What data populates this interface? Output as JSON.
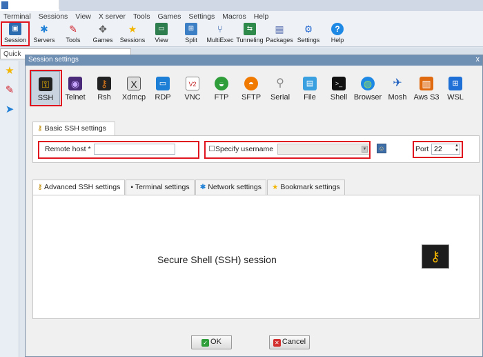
{
  "menubar": {
    "items": [
      "Terminal",
      "Sessions",
      "View",
      "X server",
      "Tools",
      "Games",
      "Settings",
      "Macros",
      "Help"
    ]
  },
  "toolbar": {
    "buttons": [
      {
        "label": "Session",
        "icon": "session-monitor-icon"
      },
      {
        "label": "Servers",
        "icon": "servers-icon"
      },
      {
        "label": "Tools",
        "icon": "tools-icon"
      },
      {
        "label": "Games",
        "icon": "games-icon"
      },
      {
        "label": "Sessions",
        "icon": "star-icon"
      },
      {
        "label": "View",
        "icon": "view-icon"
      },
      {
        "label": "Split",
        "icon": "split-icon"
      },
      {
        "label": "MultiExec",
        "icon": "multiexec-icon"
      },
      {
        "label": "Tunneling",
        "icon": "tunneling-icon"
      },
      {
        "label": "Packages",
        "icon": "packages-icon"
      },
      {
        "label": "Settings",
        "icon": "gear-icon"
      },
      {
        "label": "Help",
        "icon": "help-icon"
      }
    ]
  },
  "quick_connect": {
    "label": "Quick"
  },
  "dialog": {
    "title": "Session settings",
    "close": "x",
    "protocols": [
      {
        "label": "SSH",
        "icon": "key-icon"
      },
      {
        "label": "Telnet",
        "icon": "telnet-icon"
      },
      {
        "label": "Rsh",
        "icon": "rsh-icon"
      },
      {
        "label": "Xdmcp",
        "icon": "xdmcp-icon"
      },
      {
        "label": "RDP",
        "icon": "rdp-icon"
      },
      {
        "label": "VNC",
        "icon": "vnc-icon"
      },
      {
        "label": "FTP",
        "icon": "ftp-icon"
      },
      {
        "label": "SFTP",
        "icon": "sftp-icon"
      },
      {
        "label": "Serial",
        "icon": "serial-icon"
      },
      {
        "label": "File",
        "icon": "file-icon"
      },
      {
        "label": "Shell",
        "icon": "shell-icon"
      },
      {
        "label": "Browser",
        "icon": "browser-icon"
      },
      {
        "label": "Mosh",
        "icon": "mosh-icon"
      },
      {
        "label": "Aws S3",
        "icon": "aws-s3-icon"
      },
      {
        "label": "WSL",
        "icon": "wsl-icon"
      }
    ],
    "basic_tab": "Basic SSH settings",
    "remote_host": {
      "label": "Remote host *",
      "value": ""
    },
    "specify_username": {
      "label": "Specify username",
      "checked": false,
      "value": ""
    },
    "port": {
      "label": "Port",
      "value": "22"
    },
    "advanced_tabs": [
      "Advanced SSH settings",
      "Terminal settings",
      "Network settings",
      "Bookmark settings"
    ],
    "session_caption": "Secure Shell (SSH) session",
    "ok_label": "OK",
    "cancel_label": "Cancel"
  },
  "colors": {
    "highlight_box": "#e0141e",
    "dialog_title_bar": "#6f8fb3"
  }
}
